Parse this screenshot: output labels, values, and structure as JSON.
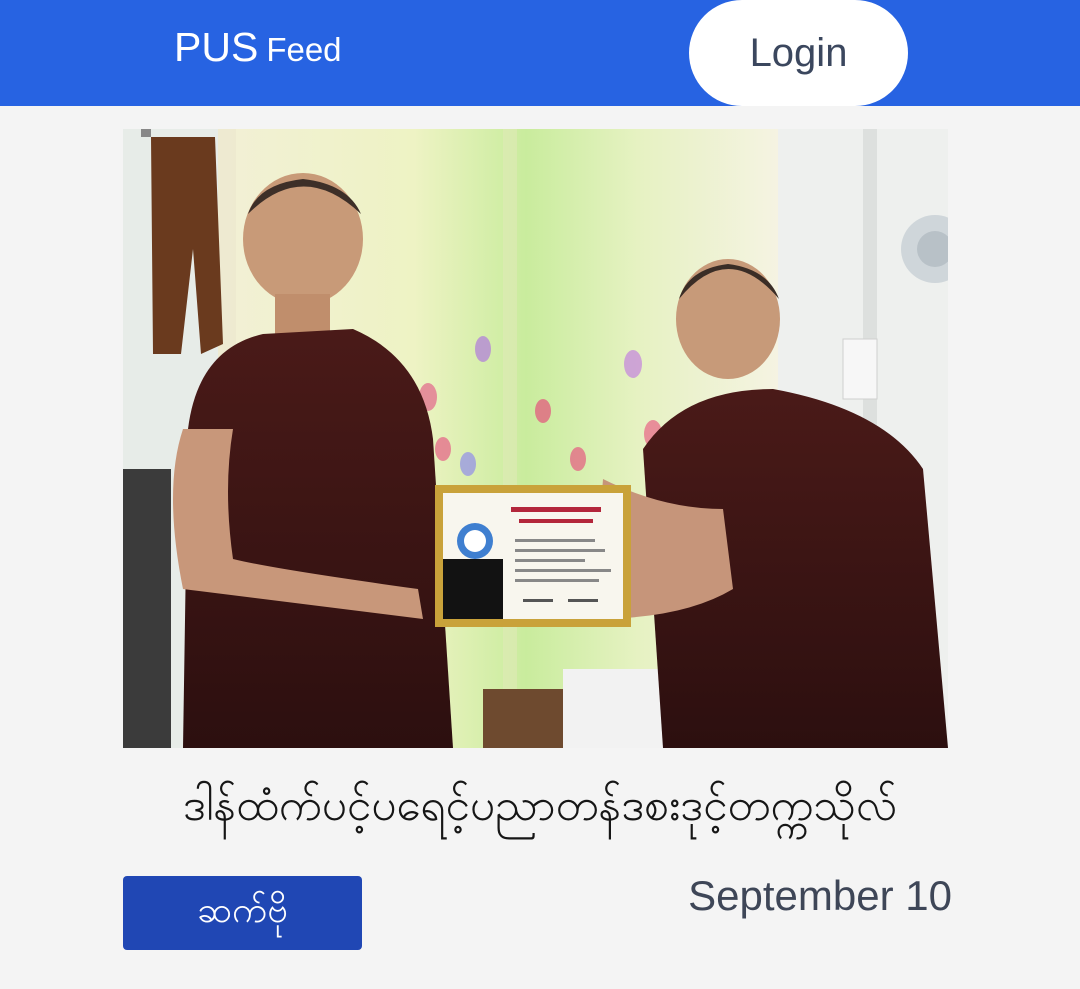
{
  "header": {
    "brand_main": "PUS",
    "brand_sub": "Feed",
    "login_label": "Login"
  },
  "post": {
    "photo_icon": "photo-certificate-presentation",
    "title": "ဒါန်ထံက်ပင့်ပရေင့်ပညာတန်ဒစးဒုင့်တက္ကသိုလ်",
    "more_label": "ဆက်ဗို",
    "date": "September 10"
  },
  "colors": {
    "header_bg": "#2763e2",
    "button_bg": "#2047b4",
    "page_bg": "#f4f4f4"
  }
}
